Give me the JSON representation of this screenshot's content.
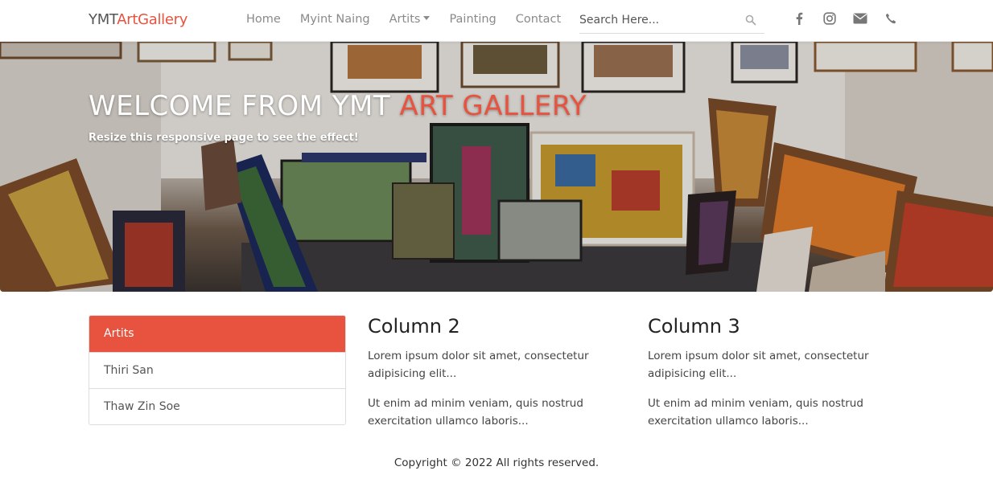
{
  "brand": {
    "part1": "YMT",
    "part2": "ArtGallery"
  },
  "nav": {
    "items": [
      {
        "label": "Home"
      },
      {
        "label": "Myint Naing"
      },
      {
        "label": "Artits"
      },
      {
        "label": "Painting"
      },
      {
        "label": "Contact"
      }
    ]
  },
  "search": {
    "placeholder": "Search Here..."
  },
  "social": [
    "facebook-icon",
    "instagram-icon",
    "envelope-icon",
    "phone-icon"
  ],
  "hero": {
    "title_main": "WELCOME FROM YMT ",
    "title_accent": "ART GALLERY",
    "subtitle": "Resize this responsive page to see the effect!"
  },
  "sidebar": {
    "items": [
      {
        "label": "Artits"
      },
      {
        "label": "Thiri San"
      },
      {
        "label": "Thaw Zin Soe"
      }
    ]
  },
  "columns": [
    {
      "title": "Column 2",
      "p1": "Lorem ipsum dolor sit amet, consectetur adipisicing elit...",
      "p2": "Ut enim ad minim veniam, quis nostrud exercitation ullamco laboris..."
    },
    {
      "title": "Column 3",
      "p1": "Lorem ipsum dolor sit amet, consectetur adipisicing elit...",
      "p2": "Ut enim ad minim veniam, quis nostrud exercitation ullamco laboris..."
    }
  ],
  "footer": {
    "text": "Copyright © 2022 All rights reserved."
  },
  "colors": {
    "accent": "#e8533f",
    "nav_text": "#8a8a8a"
  }
}
